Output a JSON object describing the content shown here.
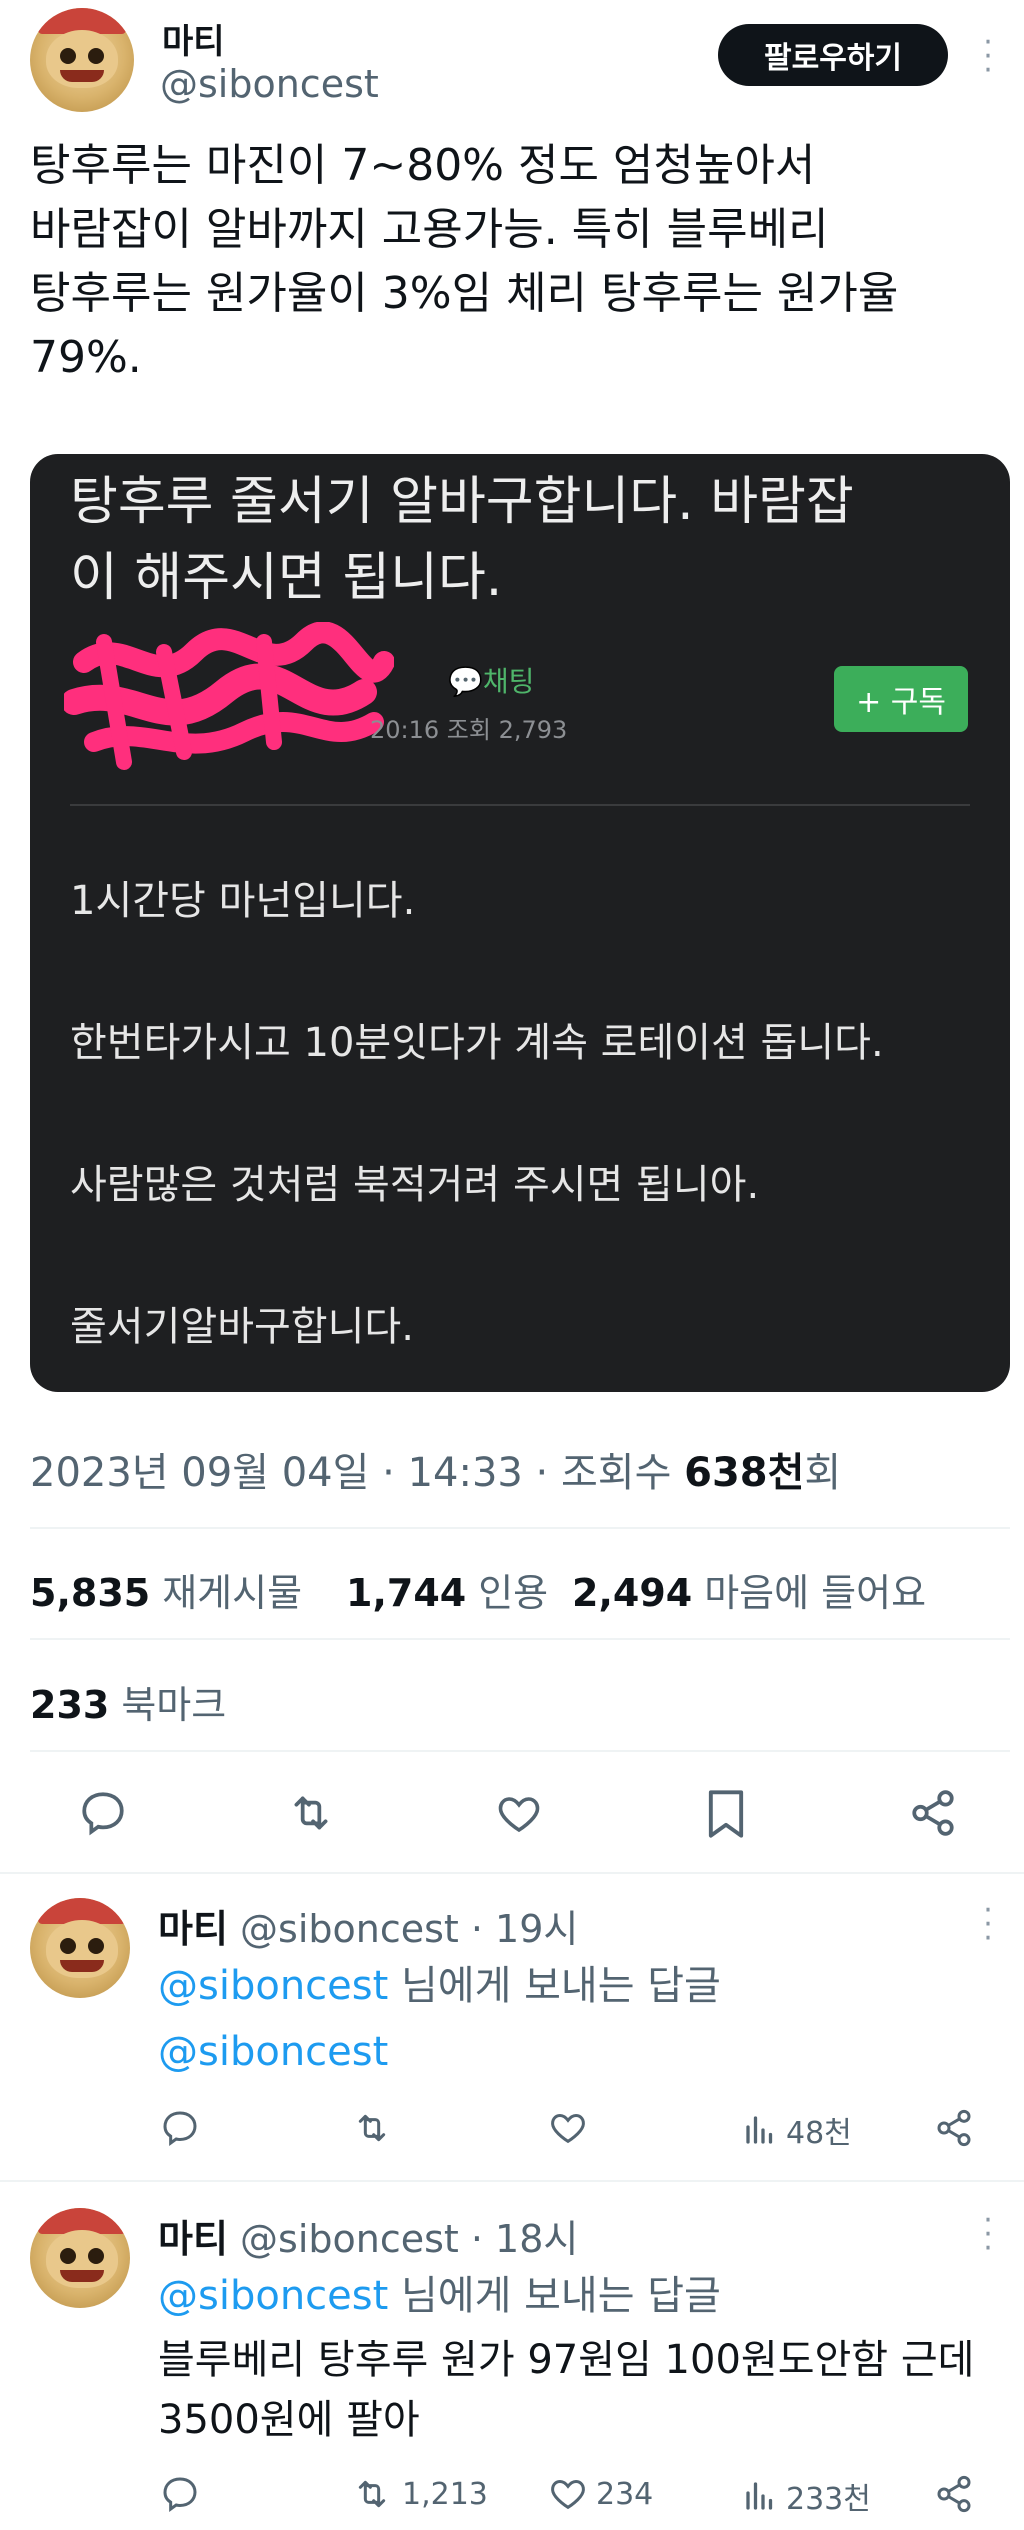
{
  "author": {
    "name": "마티",
    "handle": "@siboncest",
    "follow_label": "팔로우하기"
  },
  "tweet": {
    "text": "탕후루는 마진이 7~80% 정도 엄청높아서\n바람잡이 알바까지 고용가능. 특히 블루베리\n탕후루는 원가율이 3%임 체리 탕후루는 원가율\n79%."
  },
  "media": {
    "title": "탕후루 줄서기 알바구합니다. 바람잡\n이 해주시면 됩니다.",
    "chat_label": "채팅",
    "meta": "20:16 조회 2,793",
    "subscribe_label": "+ 구독",
    "body_lines": [
      "1시간당 마넌입니다.",
      "한번타가시고 10분잇다가 계속 로테이션 돕니다.",
      "사람많은 것처럼 북적거려 주시면 됩니아.",
      "줄서기알바구합니다."
    ]
  },
  "info": {
    "datetime": "2023년 09월 04일 · 14:33 · 조회수 ",
    "views": "638천",
    "views_suffix": "회"
  },
  "stats": {
    "retweets": "5,835",
    "retweets_label": "재게시물",
    "quotes": "1,744",
    "quotes_label": "인용",
    "likes": "2,494",
    "likes_label": "마음에 들어요",
    "bookmarks": "233",
    "bookmarks_label": "북마크"
  },
  "replies": [
    {
      "name": "마티",
      "handle": "@siboncest",
      "time": "· 19시",
      "reply_to": "@siboncest",
      "reply_to_suffix": " 님에게 보내는 답글",
      "text": "@siboncest",
      "text_is_link": true,
      "retweets": "",
      "likes": "",
      "views": "48천"
    },
    {
      "name": "마티",
      "handle": "@siboncest",
      "time": "· 18시",
      "reply_to": "@siboncest",
      "reply_to_suffix": " 님에게 보내는 답글",
      "text": "블루베리 탕후루 원가 97원임 100원도안함 근데\n3500원에 팔아",
      "text_is_link": false,
      "retweets": "1,213",
      "likes": "234",
      "views": "233천"
    }
  ],
  "colors": {
    "link": "#1d9bf0",
    "secondary": "#536471",
    "media_bg": "#1e1f21",
    "subscribe_green": "#3cae5a",
    "redaction_pink": "#ff2f7d"
  }
}
